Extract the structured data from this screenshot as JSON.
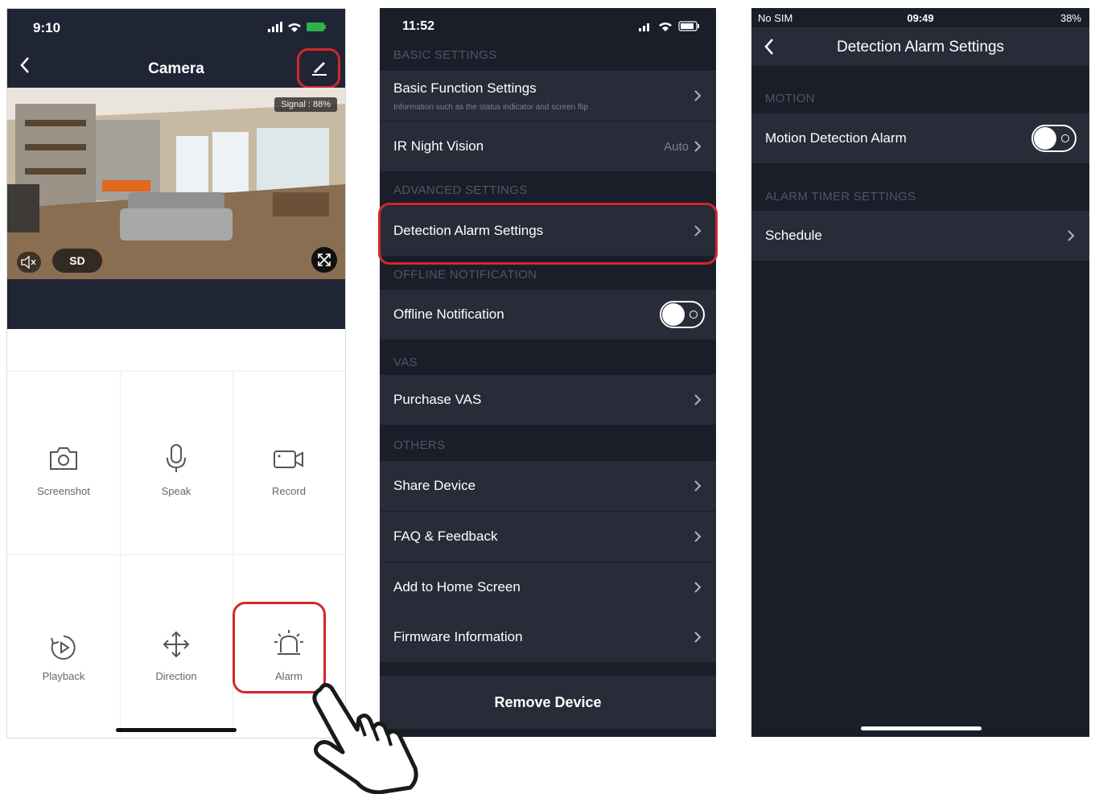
{
  "screen1": {
    "status_time": "9:10",
    "nav_title": "Camera",
    "signal": "Signal : 88%",
    "quality": "SD",
    "actions": [
      {
        "label": "Screenshot",
        "icon": "camera-icon"
      },
      {
        "label": "Speak",
        "icon": "microphone-icon"
      },
      {
        "label": "Record",
        "icon": "video-icon"
      },
      {
        "label": "Playback",
        "icon": "playback-icon"
      },
      {
        "label": "Direction",
        "icon": "direction-icon"
      },
      {
        "label": "Alarm",
        "icon": "alarm-icon"
      }
    ]
  },
  "screen2": {
    "status_time": "11:52",
    "sections": {
      "basic": "BASIC SETTINGS",
      "advanced": "ADVANCED SETTINGS",
      "offline": "OFFLINE NOTIFICATION",
      "vas": "VAS",
      "others": "OTHERS"
    },
    "basic_function": {
      "label": "Basic Function Settings",
      "sub": "Information such as the status indicator and screen flip"
    },
    "ir_night_vision": {
      "label": "IR Night Vision",
      "value": "Auto"
    },
    "detection_alarm": "Detection Alarm Settings",
    "offline_notification": {
      "label": "Offline Notification",
      "enabled": false
    },
    "purchase_vas": "Purchase VAS",
    "others": [
      "Share Device",
      "FAQ & Feedback",
      "Add to Home Screen",
      "Firmware Information"
    ],
    "remove_device": "Remove Device"
  },
  "screen3": {
    "carrier": "No SIM",
    "status_time": "09:49",
    "battery": "38%",
    "nav_title": "Detection Alarm Settings",
    "sections": {
      "motion": "MOTION",
      "timer": "ALARM TIMER SETTINGS"
    },
    "motion_alarm": {
      "label": "Motion Detection Alarm",
      "enabled": false
    },
    "schedule": "Schedule"
  },
  "colors": {
    "highlight": "#d4262e",
    "dark_bg": "#1a1e29",
    "row_bg": "#272c38",
    "section_text": "#4f5668"
  }
}
